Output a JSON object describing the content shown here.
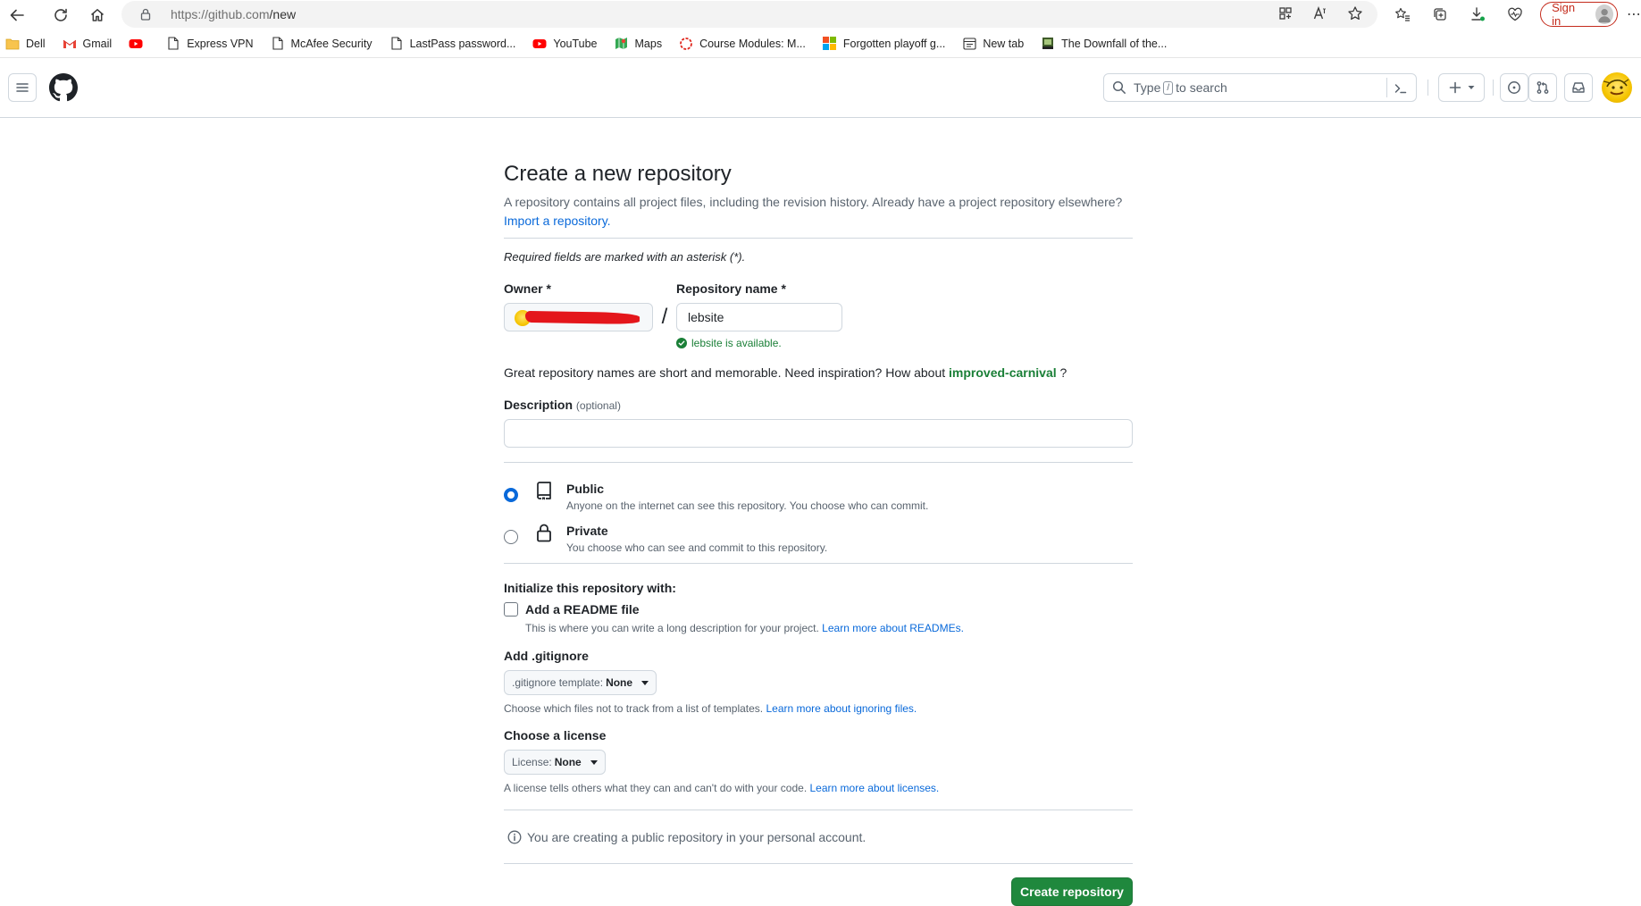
{
  "browser": {
    "url_host": "https://github.com",
    "url_path": "/new",
    "signin_label": "Sign in",
    "bookmarks": [
      {
        "label": "Dell",
        "icon": "folder-icon"
      },
      {
        "label": "Gmail",
        "icon": "gmail-icon"
      },
      {
        "label": "",
        "icon": "youtube-icon"
      },
      {
        "label": "Express VPN",
        "icon": "page-icon"
      },
      {
        "label": "McAfee Security",
        "icon": "page-icon"
      },
      {
        "label": "LastPass password...",
        "icon": "page-icon"
      },
      {
        "label": "YouTube",
        "icon": "youtube-icon"
      },
      {
        "label": "Maps",
        "icon": "maps-icon"
      },
      {
        "label": "Course Modules: M...",
        "icon": "course-icon"
      },
      {
        "label": "Forgotten playoff g...",
        "icon": "microsoft-icon"
      },
      {
        "label": "New tab",
        "icon": "newtab-icon"
      },
      {
        "label": "The Downfall of the...",
        "icon": "book-icon"
      }
    ]
  },
  "header": {
    "search_prefix": "Type",
    "search_key": "/",
    "search_suffix": "to search"
  },
  "form": {
    "title": "Create a new repository",
    "subtitle": "A repository contains all project files, including the revision history. Already have a project repository elsewhere?",
    "import_link": "Import a repository.",
    "required_note": "Required fields are marked with an asterisk (*).",
    "owner_label": "Owner *",
    "slash": "/",
    "repo_label": "Repository name *",
    "repo_value": "lebsite",
    "available_text": "lebsite is available.",
    "inspiration_prefix": "Great repository names are short and memorable. Need inspiration? How about",
    "inspiration_suggestion": "improved-carnival",
    "inspiration_suffix": "?",
    "description_label": "Description",
    "description_optional": "(optional)",
    "description_value": "",
    "visibility": [
      {
        "title": "Public",
        "desc": "Anyone on the internet can see this repository. You choose who can commit.",
        "checked": true
      },
      {
        "title": "Private",
        "desc": "You choose who can see and commit to this repository.",
        "checked": false
      }
    ],
    "init_title": "Initialize this repository with:",
    "readme_label": "Add a README file",
    "readme_note": "This is where you can write a long description for your project.",
    "readme_link": "Learn more about READMEs.",
    "gitignore_label": "Add .gitignore",
    "gitignore_btn_prefix": ".gitignore template:",
    "gitignore_btn_value": "None",
    "gitignore_note": "Choose which files not to track from a list of templates.",
    "gitignore_link": "Learn more about ignoring files.",
    "license_label": "Choose a license",
    "license_btn_prefix": "License:",
    "license_btn_value": "None",
    "license_note": "A license tells others what they can and can't do with your code.",
    "license_link": "Learn more about licenses.",
    "info_text": "You are creating a public repository in your personal account.",
    "create_label": "Create repository"
  },
  "colors": {
    "accent_blue": "#0969da",
    "success_green": "#1a7f37",
    "button_green": "#1f883d",
    "redaction_red": "#e4161b",
    "signin_red": "#c42b1c"
  }
}
